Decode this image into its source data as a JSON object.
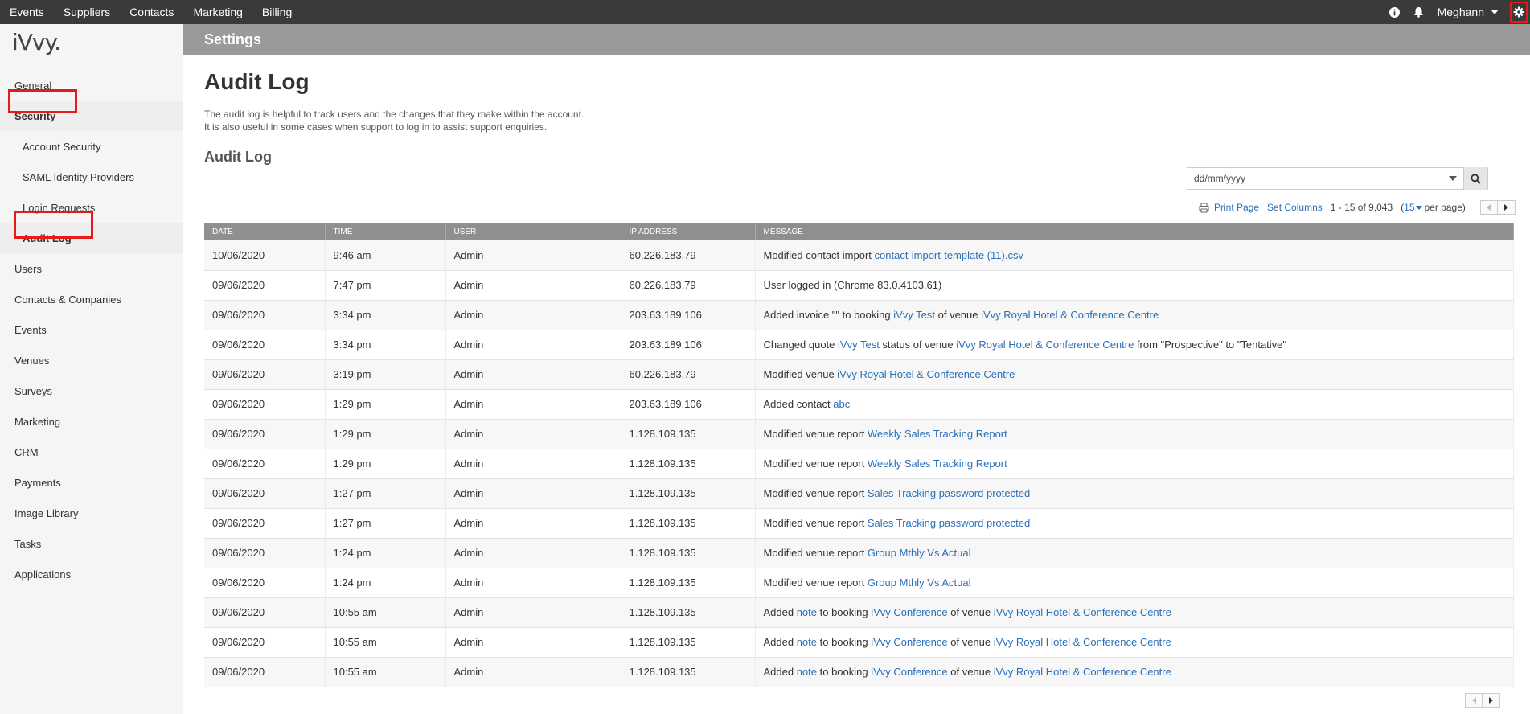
{
  "topnav": {
    "items": [
      "Events",
      "Suppliers",
      "Contacts",
      "Marketing",
      "Billing"
    ],
    "user": "Meghann",
    "icons": [
      "info-icon",
      "bell-icon",
      "gear-icon"
    ]
  },
  "annotations": [
    "1",
    "2",
    "3"
  ],
  "sidebar": {
    "logo": "iVvy",
    "items": [
      {
        "label": "General"
      },
      {
        "label": "Security"
      },
      {
        "label": "Account Security"
      },
      {
        "label": "SAML Identity Providers"
      },
      {
        "label": "Login Requests"
      },
      {
        "label": "Audit Log"
      },
      {
        "label": "Users"
      },
      {
        "label": "Contacts & Companies"
      },
      {
        "label": "Events"
      },
      {
        "label": "Venues"
      },
      {
        "label": "Surveys"
      },
      {
        "label": "Marketing"
      },
      {
        "label": "CRM"
      },
      {
        "label": "Payments"
      },
      {
        "label": "Image Library"
      },
      {
        "label": "Tasks"
      },
      {
        "label": "Applications"
      }
    ]
  },
  "header": {
    "section": "Settings"
  },
  "main": {
    "title": "Audit Log",
    "description_line1": "The audit log is helpful to track users and the changes that they make within the account.",
    "description_line2": "It is also useful in some cases when support to log in to assist support enquiries.",
    "subtitle": "Audit Log",
    "date_placeholder": "dd/mm/yyyy",
    "print_page": "Print Page",
    "set_columns": "Set Columns",
    "range": "1 - 15 of 9,043",
    "per_page_open": "(",
    "per_page_value": "15",
    "per_page_close": "per page)"
  },
  "table": {
    "columns": [
      "DATE",
      "TIME",
      "USER",
      "IP ADDRESS",
      "MESSAGE"
    ],
    "rows": [
      {
        "date": "10/06/2020",
        "time": "9:46 am",
        "user": "Admin",
        "ip": "60.226.183.79",
        "msg": [
          {
            "t": "Modified contact import "
          },
          {
            "t": "contact-import-template (11).csv",
            "link": true
          }
        ]
      },
      {
        "date": "09/06/2020",
        "time": "7:47 pm",
        "user": "Admin",
        "ip": "60.226.183.79",
        "msg": [
          {
            "t": "User logged in (Chrome 83.0.4103.61)"
          }
        ]
      },
      {
        "date": "09/06/2020",
        "time": "3:34 pm",
        "user": "Admin",
        "ip": "203.63.189.106",
        "msg": [
          {
            "t": "Added invoice \"\" to booking "
          },
          {
            "t": "iVvy Test",
            "link": true
          },
          {
            "t": " of venue "
          },
          {
            "t": "iVvy Royal Hotel & Conference Centre",
            "link": true
          }
        ]
      },
      {
        "date": "09/06/2020",
        "time": "3:34 pm",
        "user": "Admin",
        "ip": "203.63.189.106",
        "msg": [
          {
            "t": "Changed quote "
          },
          {
            "t": "iVvy Test",
            "link": true
          },
          {
            "t": " status of venue "
          },
          {
            "t": "iVvy Royal Hotel & Conference Centre",
            "link": true
          },
          {
            "t": " from \"Prospective\" to \"Tentative\""
          }
        ]
      },
      {
        "date": "09/06/2020",
        "time": "3:19 pm",
        "user": "Admin",
        "ip": "60.226.183.79",
        "msg": [
          {
            "t": "Modified venue "
          },
          {
            "t": "iVvy Royal Hotel & Conference Centre",
            "link": true
          }
        ]
      },
      {
        "date": "09/06/2020",
        "time": "1:29 pm",
        "user": "Admin",
        "ip": "203.63.189.106",
        "msg": [
          {
            "t": "Added contact "
          },
          {
            "t": "abc",
            "link": true
          }
        ]
      },
      {
        "date": "09/06/2020",
        "time": "1:29 pm",
        "user": "Admin",
        "ip": "1.128.109.135",
        "msg": [
          {
            "t": "Modified venue report "
          },
          {
            "t": "Weekly Sales Tracking Report",
            "link": true
          }
        ]
      },
      {
        "date": "09/06/2020",
        "time": "1:29 pm",
        "user": "Admin",
        "ip": "1.128.109.135",
        "msg": [
          {
            "t": "Modified venue report "
          },
          {
            "t": "Weekly Sales Tracking Report",
            "link": true
          }
        ]
      },
      {
        "date": "09/06/2020",
        "time": "1:27 pm",
        "user": "Admin",
        "ip": "1.128.109.135",
        "msg": [
          {
            "t": "Modified venue report "
          },
          {
            "t": "Sales Tracking password protected",
            "link": true
          }
        ]
      },
      {
        "date": "09/06/2020",
        "time": "1:27 pm",
        "user": "Admin",
        "ip": "1.128.109.135",
        "msg": [
          {
            "t": "Modified venue report "
          },
          {
            "t": "Sales Tracking password protected",
            "link": true
          }
        ]
      },
      {
        "date": "09/06/2020",
        "time": "1:24 pm",
        "user": "Admin",
        "ip": "1.128.109.135",
        "msg": [
          {
            "t": "Modified venue report "
          },
          {
            "t": "Group Mthly Vs Actual",
            "link": true
          }
        ]
      },
      {
        "date": "09/06/2020",
        "time": "1:24 pm",
        "user": "Admin",
        "ip": "1.128.109.135",
        "msg": [
          {
            "t": "Modified venue report "
          },
          {
            "t": "Group Mthly Vs Actual",
            "link": true
          }
        ]
      },
      {
        "date": "09/06/2020",
        "time": "10:55 am",
        "user": "Admin",
        "ip": "1.128.109.135",
        "msg": [
          {
            "t": "Added "
          },
          {
            "t": "note",
            "link": true
          },
          {
            "t": " to booking "
          },
          {
            "t": "iVvy Conference",
            "link": true
          },
          {
            "t": " of venue "
          },
          {
            "t": "iVvy Royal Hotel & Conference Centre",
            "link": true
          }
        ]
      },
      {
        "date": "09/06/2020",
        "time": "10:55 am",
        "user": "Admin",
        "ip": "1.128.109.135",
        "msg": [
          {
            "t": "Added "
          },
          {
            "t": "note",
            "link": true
          },
          {
            "t": " to booking "
          },
          {
            "t": "iVvy Conference",
            "link": true
          },
          {
            "t": " of venue "
          },
          {
            "t": "iVvy Royal Hotel & Conference Centre",
            "link": true
          }
        ]
      },
      {
        "date": "09/06/2020",
        "time": "10:55 am",
        "user": "Admin",
        "ip": "1.128.109.135",
        "msg": [
          {
            "t": "Added "
          },
          {
            "t": "note",
            "link": true
          },
          {
            "t": " to booking "
          },
          {
            "t": "iVvy Conference",
            "link": true
          },
          {
            "t": " of venue "
          },
          {
            "t": "iVvy Royal Hotel & Conference Centre",
            "link": true
          }
        ]
      }
    ]
  },
  "colors": {
    "topbar": "#3a3a3a",
    "settings_bar": "#999a9c",
    "table_header": "#8e8f91",
    "link": "#2a70b9",
    "annotation": "#e31b1b"
  }
}
